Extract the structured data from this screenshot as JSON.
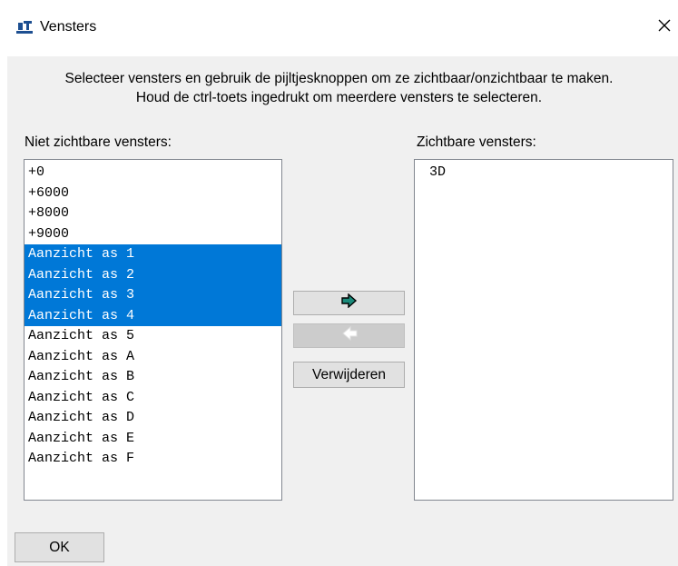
{
  "window": {
    "title": "Vensters",
    "close_glyph": "✕"
  },
  "instructions": {
    "line1": "Selecteer vensters en gebruik de pijltjesknoppen om ze zichtbaar/onzichtbaar te maken.",
    "line2": "Houd de ctrl-toets ingedrukt om meerdere vensters te selecteren."
  },
  "hidden_windows": {
    "label": "Niet zichtbare vensters:",
    "items": [
      {
        "label": "+0",
        "selected": false
      },
      {
        "label": "+6000",
        "selected": false
      },
      {
        "label": "+8000",
        "selected": false
      },
      {
        "label": "+9000",
        "selected": false
      },
      {
        "label": "Aanzicht as 1",
        "selected": true
      },
      {
        "label": "Aanzicht as 2",
        "selected": true
      },
      {
        "label": "Aanzicht as 3",
        "selected": true
      },
      {
        "label": "Aanzicht as 4",
        "selected": true
      },
      {
        "label": "Aanzicht as 5",
        "selected": false
      },
      {
        "label": "Aanzicht as A",
        "selected": false
      },
      {
        "label": "Aanzicht as B",
        "selected": false
      },
      {
        "label": "Aanzicht as C",
        "selected": false
      },
      {
        "label": "Aanzicht as D",
        "selected": false
      },
      {
        "label": "Aanzicht as E",
        "selected": false
      },
      {
        "label": "Aanzicht as F",
        "selected": false
      }
    ]
  },
  "visible_windows": {
    "label": "Zichtbare vensters:",
    "items": [
      {
        "label": "3D",
        "selected": false
      }
    ]
  },
  "buttons": {
    "move_right_icon": "arrow-right-icon",
    "move_left_icon": "arrow-left-icon",
    "move_left_enabled": false,
    "remove_label": "Verwijderen",
    "ok_label": "OK"
  },
  "colors": {
    "selection": "#0078d7",
    "dialog_bg": "#f0f0f0",
    "arrow_fill": "#1a8a7a",
    "arrow_disabled": "#ffffff"
  }
}
